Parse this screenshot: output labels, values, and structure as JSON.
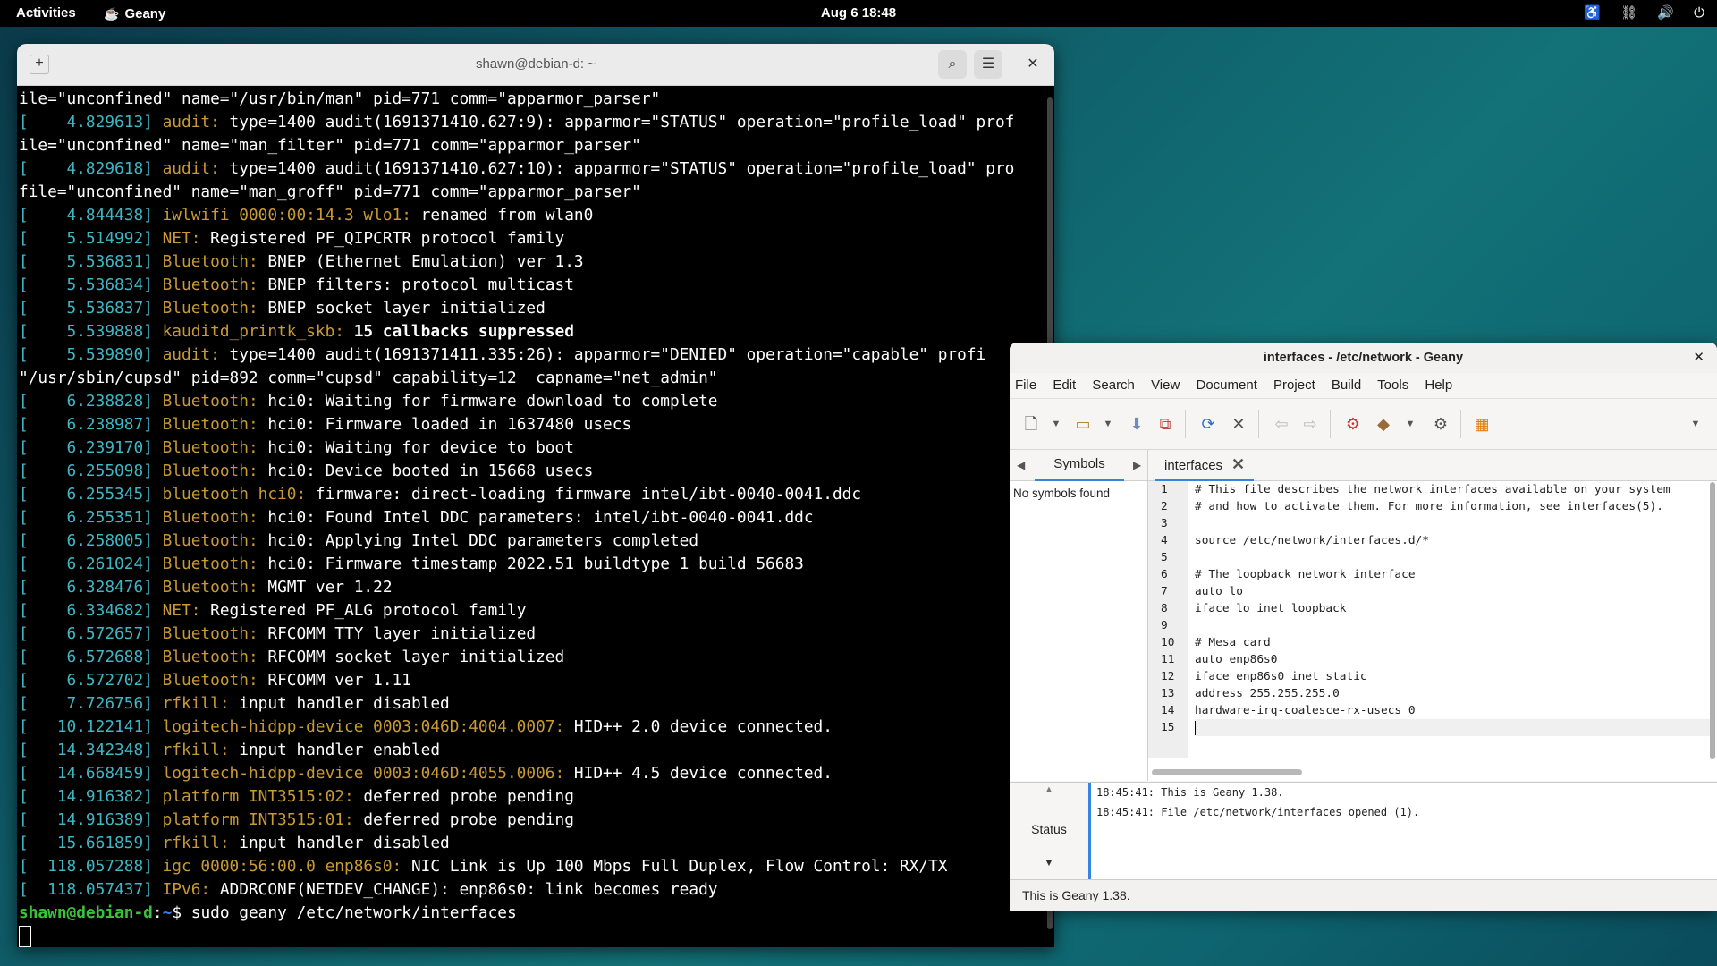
{
  "topbar": {
    "activities": "Activities",
    "app_name": "Geany",
    "clock": "Aug 6  18:48"
  },
  "terminal": {
    "title": "shawn@debian-d: ~",
    "lines": [
      [
        {
          "t": "ile=\"unconfined\" name=\"/usr/bin/man\" pid=771 comm=\"apparmor_parser\"",
          "c": ""
        }
      ],
      [
        {
          "t": "[    4.829613] ",
          "c": "c-br"
        },
        {
          "t": "audit: ",
          "c": "c-src"
        },
        {
          "t": "type=1400 audit(1691371410.627:9): apparmor=\"STATUS\" operation=\"profile_load\" prof",
          "c": ""
        }
      ],
      [
        {
          "t": "ile=\"unconfined\" name=\"man_filter\" pid=771 comm=\"apparmor_parser\"",
          "c": ""
        }
      ],
      [
        {
          "t": "[    4.829618] ",
          "c": "c-br"
        },
        {
          "t": "audit: ",
          "c": "c-src"
        },
        {
          "t": "type=1400 audit(1691371410.627:10): apparmor=\"STATUS\" operation=\"profile_load\" pro",
          "c": ""
        }
      ],
      [
        {
          "t": "file=\"unconfined\" name=\"man_groff\" pid=771 comm=\"apparmor_parser\"",
          "c": ""
        }
      ],
      [
        {
          "t": "[    4.844438] ",
          "c": "c-br"
        },
        {
          "t": "iwlwifi 0000:00:14.3 wlo1: ",
          "c": "c-src"
        },
        {
          "t": "renamed from wlan0",
          "c": ""
        }
      ],
      [
        {
          "t": "[    5.514992] ",
          "c": "c-br"
        },
        {
          "t": "NET: ",
          "c": "c-src"
        },
        {
          "t": "Registered PF_QIPCRTR protocol family",
          "c": ""
        }
      ],
      [
        {
          "t": "[    5.536831] ",
          "c": "c-br"
        },
        {
          "t": "Bluetooth: ",
          "c": "c-src"
        },
        {
          "t": "BNEP (Ethernet Emulation) ver 1.3",
          "c": ""
        }
      ],
      [
        {
          "t": "[    5.536834] ",
          "c": "c-br"
        },
        {
          "t": "Bluetooth: ",
          "c": "c-src"
        },
        {
          "t": "BNEP filters: protocol multicast",
          "c": ""
        }
      ],
      [
        {
          "t": "[    5.536837] ",
          "c": "c-br"
        },
        {
          "t": "Bluetooth: ",
          "c": "c-src"
        },
        {
          "t": "BNEP socket layer initialized",
          "c": ""
        }
      ],
      [
        {
          "t": "[    5.539888] ",
          "c": "c-br"
        },
        {
          "t": "kauditd_printk_skb: ",
          "c": "c-src"
        },
        {
          "t": "15 callbacks suppressed",
          "c": "c-bold"
        }
      ],
      [
        {
          "t": "[    5.539890] ",
          "c": "c-br"
        },
        {
          "t": "audit: ",
          "c": "c-src"
        },
        {
          "t": "type=1400 audit(1691371411.335:26): apparmor=\"DENIED\" operation=\"capable\" profi",
          "c": ""
        }
      ],
      [
        {
          "t": "\"/usr/sbin/cupsd\" pid=892 comm=\"cupsd\" capability=12  capname=\"net_admin\"",
          "c": ""
        }
      ],
      [
        {
          "t": "[    6.238828] ",
          "c": "c-br"
        },
        {
          "t": "Bluetooth: ",
          "c": "c-src"
        },
        {
          "t": "hci0: Waiting for firmware download to complete",
          "c": ""
        }
      ],
      [
        {
          "t": "[    6.238987] ",
          "c": "c-br"
        },
        {
          "t": "Bluetooth: ",
          "c": "c-src"
        },
        {
          "t": "hci0: Firmware loaded in 1637480 usecs",
          "c": ""
        }
      ],
      [
        {
          "t": "[    6.239170] ",
          "c": "c-br"
        },
        {
          "t": "Bluetooth: ",
          "c": "c-src"
        },
        {
          "t": "hci0: Waiting for device to boot",
          "c": ""
        }
      ],
      [
        {
          "t": "[    6.255098] ",
          "c": "c-br"
        },
        {
          "t": "Bluetooth: ",
          "c": "c-src"
        },
        {
          "t": "hci0: Device booted in 15668 usecs",
          "c": ""
        }
      ],
      [
        {
          "t": "[    6.255345] ",
          "c": "c-br"
        },
        {
          "t": "bluetooth hci0: ",
          "c": "c-src"
        },
        {
          "t": "firmware: direct-loading firmware intel/ibt-0040-0041.ddc",
          "c": ""
        }
      ],
      [
        {
          "t": "[    6.255351] ",
          "c": "c-br"
        },
        {
          "t": "Bluetooth: ",
          "c": "c-src"
        },
        {
          "t": "hci0: Found Intel DDC parameters: intel/ibt-0040-0041.ddc",
          "c": ""
        }
      ],
      [
        {
          "t": "[    6.258005] ",
          "c": "c-br"
        },
        {
          "t": "Bluetooth: ",
          "c": "c-src"
        },
        {
          "t": "hci0: Applying Intel DDC parameters completed",
          "c": ""
        }
      ],
      [
        {
          "t": "[    6.261024] ",
          "c": "c-br"
        },
        {
          "t": "Bluetooth: ",
          "c": "c-src"
        },
        {
          "t": "hci0: Firmware timestamp 2022.51 buildtype 1 build 56683",
          "c": ""
        }
      ],
      [
        {
          "t": "[    6.328476] ",
          "c": "c-br"
        },
        {
          "t": "Bluetooth: ",
          "c": "c-src"
        },
        {
          "t": "MGMT ver 1.22",
          "c": ""
        }
      ],
      [
        {
          "t": "[    6.334682] ",
          "c": "c-br"
        },
        {
          "t": "NET: ",
          "c": "c-src"
        },
        {
          "t": "Registered PF_ALG protocol family",
          "c": ""
        }
      ],
      [
        {
          "t": "[    6.572657] ",
          "c": "c-br"
        },
        {
          "t": "Bluetooth: ",
          "c": "c-src"
        },
        {
          "t": "RFCOMM TTY layer initialized",
          "c": ""
        }
      ],
      [
        {
          "t": "[    6.572688] ",
          "c": "c-br"
        },
        {
          "t": "Bluetooth: ",
          "c": "c-src"
        },
        {
          "t": "RFCOMM socket layer initialized",
          "c": ""
        }
      ],
      [
        {
          "t": "[    6.572702] ",
          "c": "c-br"
        },
        {
          "t": "Bluetooth: ",
          "c": "c-src"
        },
        {
          "t": "RFCOMM ver 1.11",
          "c": ""
        }
      ],
      [
        {
          "t": "[    7.726756] ",
          "c": "c-br"
        },
        {
          "t": "rfkill: ",
          "c": "c-src"
        },
        {
          "t": "input handler disabled",
          "c": ""
        }
      ],
      [
        {
          "t": "[   10.122141] ",
          "c": "c-br"
        },
        {
          "t": "logitech-hidpp-device 0003:046D:4004.0007: ",
          "c": "c-src"
        },
        {
          "t": "HID++ 2.0 device connected.",
          "c": ""
        }
      ],
      [
        {
          "t": "[   14.342348] ",
          "c": "c-br"
        },
        {
          "t": "rfkill: ",
          "c": "c-src"
        },
        {
          "t": "input handler enabled",
          "c": ""
        }
      ],
      [
        {
          "t": "[   14.668459] ",
          "c": "c-br"
        },
        {
          "t": "logitech-hidpp-device 0003:046D:4055.0006: ",
          "c": "c-src"
        },
        {
          "t": "HID++ 4.5 device connected.",
          "c": ""
        }
      ],
      [
        {
          "t": "[   14.916382] ",
          "c": "c-br"
        },
        {
          "t": "platform INT3515:02: ",
          "c": "c-src"
        },
        {
          "t": "deferred probe pending",
          "c": ""
        }
      ],
      [
        {
          "t": "[   14.916389] ",
          "c": "c-br"
        },
        {
          "t": "platform INT3515:01: ",
          "c": "c-src"
        },
        {
          "t": "deferred probe pending",
          "c": ""
        }
      ],
      [
        {
          "t": "[   15.661859] ",
          "c": "c-br"
        },
        {
          "t": "rfkill: ",
          "c": "c-src"
        },
        {
          "t": "input handler disabled",
          "c": ""
        }
      ],
      [
        {
          "t": "[  118.057288] ",
          "c": "c-br"
        },
        {
          "t": "igc 0000:56:00.0 enp86s0: ",
          "c": "c-src"
        },
        {
          "t": "NIC Link is Up 100 Mbps Full Duplex, Flow Control: RX/TX",
          "c": ""
        }
      ],
      [
        {
          "t": "[  118.057437] ",
          "c": "c-br"
        },
        {
          "t": "IPv6: ",
          "c": "c-src"
        },
        {
          "t": "ADDRCONF(NETDEV_CHANGE): enp86s0: link becomes ready",
          "c": ""
        }
      ]
    ],
    "prompt_user": "shawn@debian-d",
    "prompt_sep": ":",
    "prompt_path": "~",
    "prompt_symbol": "$ ",
    "command": "sudo geany /etc/network/interfaces"
  },
  "geany": {
    "title": "interfaces - /etc/network - Geany",
    "menu": [
      "File",
      "Edit",
      "Search",
      "View",
      "Document",
      "Project",
      "Build",
      "Tools",
      "Help"
    ],
    "sidebar_tab": "Symbols",
    "no_symbols": "No symbols found",
    "file_tab": "interfaces",
    "code_lines": [
      "# This file describes the network interfaces available on your system",
      "# and how to activate them. For more information, see interfaces(5).",
      "",
      "source /etc/network/interfaces.d/*",
      "",
      "# The loopback network interface",
      "auto lo",
      "iface lo inet loopback",
      "",
      "# Mesa card",
      "auto enp86s0",
      "iface enp86s0 inet static",
      "address 255.255.255.0",
      "hardware-irq-coalesce-rx-usecs 0",
      ""
    ],
    "msg_label": "Status",
    "messages": [
      "18:45:41: This is Geany 1.38.",
      "18:45:41: File /etc/network/interfaces opened (1)."
    ],
    "statusbar": "This is Geany 1.38."
  }
}
